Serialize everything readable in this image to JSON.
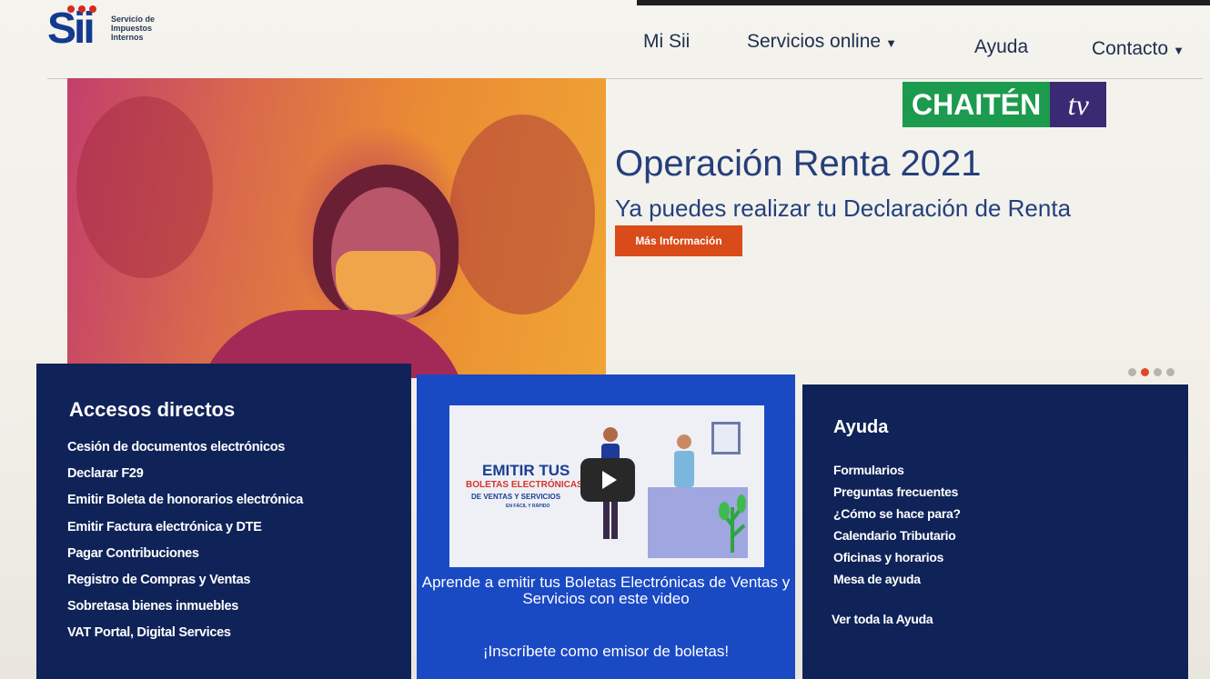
{
  "header": {
    "logo_text": [
      "Servicio de",
      "Impuestos",
      "Internos"
    ],
    "logo_mark": "Sii",
    "nav": [
      {
        "label": "Mi Sii",
        "has_dropdown": false
      },
      {
        "label": "Servicios online",
        "has_dropdown": true
      },
      {
        "label": "Ayuda",
        "has_dropdown": false
      },
      {
        "label": "Contacto",
        "has_dropdown": true
      }
    ]
  },
  "hero": {
    "title": "Operación Renta 2021",
    "subtitle": "Ya puedes realizar tu Declaración de Renta",
    "button_label": "Más Información",
    "carousel_slides": 4,
    "carousel_active": 2
  },
  "watermark": {
    "left": "CHAITÉN",
    "right": "tv"
  },
  "accesos": {
    "title": "Accesos directos",
    "items": [
      "Cesión de documentos electrónicos",
      "Declarar F29",
      "Emitir Boleta de honorarios electrónica",
      "Emitir Factura electrónica y DTE",
      "Pagar Contribuciones",
      "Registro de Compras y Ventas",
      "Sobretasa bienes inmuebles",
      "VAT Portal, Digital Services"
    ]
  },
  "video": {
    "thumb_line1": "EMITIR TUS",
    "thumb_line2": "BOLETAS ELECTRÓNICAS",
    "thumb_line3": "DE VENTAS Y SERVICIOS",
    "thumb_line4": "EN FÁCIL Y RÁPIDO",
    "caption": "Aprende a emitir tus  Boletas Electrónicas de Ventas y Servicios con este video",
    "link": "¡Inscríbete como emisor de boletas!"
  },
  "ayuda": {
    "title": "Ayuda",
    "items": [
      "Formularios",
      "Preguntas frecuentes",
      "¿Cómo se hace para?",
      "Calendario Tributario",
      "Oficinas y horarios",
      "Mesa de ayuda"
    ],
    "all_link": "Ver toda la Ayuda"
  },
  "colors": {
    "brand_blue": "#123b8e",
    "panel_navy": "#0f2358",
    "panel_blue": "#1a49c4",
    "cta_orange": "#d94b18",
    "watermark_green": "#1c9a4d",
    "watermark_purple": "#3a2a73"
  }
}
